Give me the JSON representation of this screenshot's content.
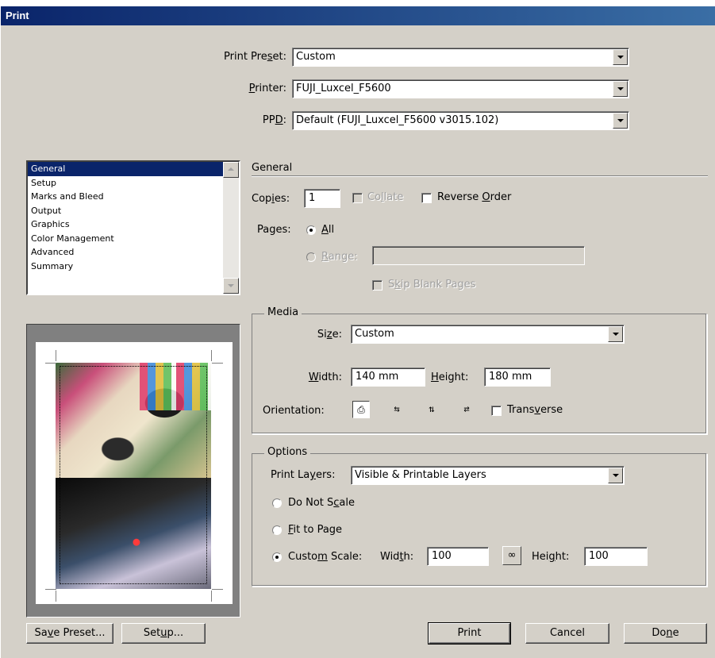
{
  "window": {
    "title": "Print"
  },
  "header": {
    "preset": {
      "label_pre": "Print Pre",
      "label_key": "s",
      "label_post": "et:",
      "value": "Custom"
    },
    "printer": {
      "label_pre": "",
      "label_key": "P",
      "label_post": "rinter:",
      "value": "FUJI_Luxcel_F5600"
    },
    "ppd": {
      "label_pre": "PP",
      "label_key": "D",
      "label_post": ":",
      "value": "Default (FUJI_Luxcel_F5600 v3015.102)"
    }
  },
  "sidebar": {
    "items": [
      {
        "label": "General",
        "selected": true
      },
      {
        "label": "Setup"
      },
      {
        "label": "Marks and Bleed"
      },
      {
        "label": "Output"
      },
      {
        "label": "Graphics"
      },
      {
        "label": "Color Management"
      },
      {
        "label": "Advanced"
      },
      {
        "label": "Summary"
      }
    ]
  },
  "general": {
    "section_title": "General",
    "copies": {
      "label_pre": "Cop",
      "label_key": "i",
      "label_post": "es:",
      "value": "1"
    },
    "collate": {
      "label_pre": "Co",
      "label_key": "l",
      "label_post": "late",
      "checked": false,
      "enabled": false
    },
    "reverse_order": {
      "label_pre": "Reverse ",
      "label_key": "O",
      "label_post": "rder",
      "checked": false
    },
    "pages_label": "Pages:",
    "all": {
      "label_pre": "",
      "label_key": "A",
      "label_post": "ll",
      "selected": true
    },
    "range": {
      "label_pre": "",
      "label_key": "R",
      "label_post": "ange:",
      "value": "",
      "enabled": false
    },
    "skip_blank": {
      "label_pre": "S",
      "label_key": "k",
      "label_post": "ip Blank Pages",
      "checked": false,
      "enabled": false
    }
  },
  "media": {
    "title": "Media",
    "size": {
      "label_pre": "Si",
      "label_key": "z",
      "label_post": "e:",
      "value": "Custom"
    },
    "width": {
      "label_pre": "",
      "label_key": "W",
      "label_post": "idth:",
      "value": "140 mm"
    },
    "height": {
      "label_pre": "",
      "label_key": "H",
      "label_post": "eight:",
      "value": "180 mm"
    },
    "orientation_label": "Orientation:",
    "orientation_icons": [
      "portrait-icon",
      "landscape-icon",
      "reverse-portrait-icon",
      "reverse-landscape-icon"
    ],
    "transverse": {
      "label_pre": "Trans",
      "label_key": "v",
      "label_post": "erse",
      "checked": false
    }
  },
  "options": {
    "title": "Options",
    "print_layers": {
      "label_pre": "Print La",
      "label_key": "y",
      "label_post": "ers:",
      "value": "Visible & Printable Layers"
    },
    "do_not_scale": {
      "label_pre": "Do Not S",
      "label_key": "c",
      "label_post": "ale",
      "selected": false
    },
    "fit_to_page": {
      "label_pre": "",
      "label_key": "F",
      "label_post": "it to Page",
      "selected": false
    },
    "custom_scale": {
      "label_pre": "Custo",
      "label_key": "m",
      "label_post": " Scale:",
      "selected": true
    },
    "scale_width": {
      "label_pre": "Wid",
      "label_key": "t",
      "label_post": "h:",
      "value": "100"
    },
    "scale_height": {
      "label_pre": "Hei",
      "label_key": "g",
      "label_post": "ht:",
      "value": "100"
    }
  },
  "footer": {
    "save_preset": {
      "label_pre": "Sa",
      "label_key": "v",
      "label_post": "e Preset..."
    },
    "setup": {
      "label_pre": "Set",
      "label_key": "u",
      "label_post": "p..."
    },
    "print": {
      "label": "Print"
    },
    "cancel": {
      "label": "Cancel"
    },
    "done": {
      "label_pre": "Do",
      "label_key": "n",
      "label_post": "e"
    }
  },
  "colors": {
    "face": "#d4d0c8",
    "title_start": "#0a246a",
    "title_end": "#3a6ea5",
    "selection": "#0a246a"
  }
}
